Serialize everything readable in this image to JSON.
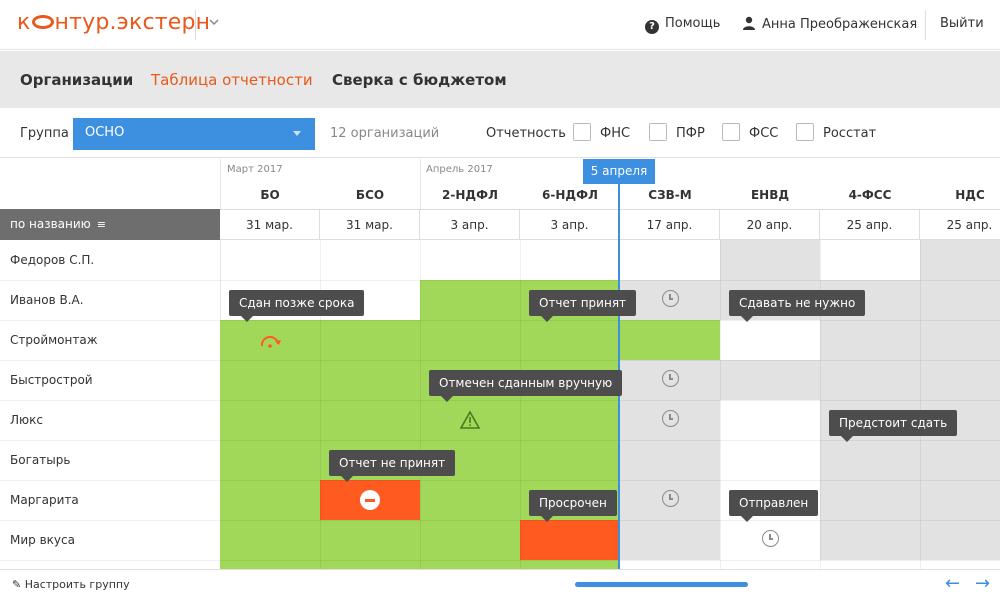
{
  "header": {
    "logo_left": "к",
    "logo_right": "нтур.экстерн",
    "help": "Помощь",
    "user": "Анна Преображенская",
    "logout": "Выйти"
  },
  "nav": {
    "items": [
      "Организации",
      "Таблица отчетности",
      "Сверка с бюджетом"
    ]
  },
  "filter": {
    "group_label": "Группа",
    "group_value": "ОСНО",
    "count": "12 организаций",
    "reporting_label": "Отчетность",
    "checkboxes": [
      "ФНС",
      "ПФР",
      "ФСС",
      "Росстат"
    ]
  },
  "grid": {
    "periods": [
      "Март 2017",
      "Апрель 2017"
    ],
    "today": "5 апреля",
    "sort_label": "по названию",
    "columns": [
      "БО",
      "БСО",
      "2-НДФЛ",
      "6-НДФЛ",
      "СЗВ-М",
      "ЕНВД",
      "4-ФСС",
      "НДС"
    ],
    "dates": [
      "31 мар.",
      "31 мар.",
      "3 апр.",
      "3 апр.",
      "17 апр.",
      "20 апр.",
      "25 апр.",
      "25 апр."
    ],
    "rows": [
      "Федоров С.П.",
      "Иванов В.А.",
      "Строймонтаж",
      "Быстрострой",
      "Люкс",
      "Богатырь",
      "Маргарита",
      "Мир вкуса"
    ],
    "tooltips": {
      "late": "Сдан позже срока",
      "accepted": "Отчет принят",
      "not_needed": "Сдавать не нужно",
      "manual": "Отмечен сданным вручную",
      "upcoming": "Предстоит сдать",
      "not_accepted": "Отчет не принят",
      "overdue": "Просрочен",
      "sent": "Отправлен"
    }
  },
  "footer": {
    "configure": "Настроить группу"
  },
  "colors": {
    "green": "#a2d85a",
    "gray": "#e2e2e2",
    "orange": "#ff5a1f",
    "blue": "#3d8fe0",
    "brand": "#e8591a"
  }
}
